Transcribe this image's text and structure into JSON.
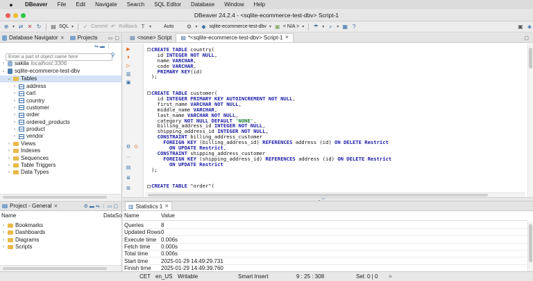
{
  "menubar": {
    "app": "DBeaver",
    "items": [
      "File",
      "Edit",
      "Navigate",
      "Search",
      "SQL Editor",
      "Database",
      "Window",
      "Help"
    ]
  },
  "window": {
    "title": "DBeaver 24.2.4 - <sqlite-ecommerce-test-dbv> Script-1"
  },
  "toolbar": {
    "sql_label": "SQL",
    "commit_label": "Commit",
    "rollback_label": "Rollback",
    "tx_mode_label": "Auto",
    "datasource_label": "sqlite-ecommerce-test-dbv",
    "schema_label": "< N/A >"
  },
  "navigator": {
    "tab_label": "Database Navigator",
    "projects_tab_label": "Projects",
    "filter_placeholder": "Enter a part of object name here",
    "connections": [
      {
        "name": "sakila",
        "detail": "localhost:3306"
      },
      {
        "name": "sqlite-ecommerce-test-dbv"
      }
    ],
    "tables_folder": "Tables",
    "tables": [
      "address",
      "cart",
      "country",
      "customer",
      "order",
      "ordered_products",
      "product",
      "vendor"
    ],
    "other_folders": [
      "Views",
      "Indexes",
      "Sequences",
      "Table Triggers",
      "Data Types"
    ]
  },
  "project": {
    "tab_label": "Project - General",
    "col_name": "Name",
    "col_datasource": "DataSo",
    "items": [
      "Bookmarks",
      "Dashboards",
      "Diagrams",
      "Scripts"
    ]
  },
  "editor": {
    "tabs": [
      "<none> Script",
      "*<sqlite-ecommerce-test-dbv> Script-1"
    ],
    "lines": [
      [
        [
          "kw",
          "CREATE TABLE "
        ],
        [
          "n",
          "country("
        ]
      ],
      [
        [
          "n",
          "  id "
        ],
        [
          "kw",
          "INTEGER NOT NULL"
        ],
        [
          "n",
          ","
        ]
      ],
      [
        [
          "n",
          "  name "
        ],
        [
          "kw",
          "VARCHAR"
        ],
        [
          "n",
          ","
        ]
      ],
      [
        [
          "n",
          "  code "
        ],
        [
          "kw",
          "VARCHAR"
        ],
        [
          "n",
          ","
        ]
      ],
      [
        [
          "kw",
          "  PRIMARY KEY"
        ],
        [
          "n",
          "(id)"
        ]
      ],
      [
        [
          "n",
          ");"
        ]
      ],
      [
        [
          "n",
          ""
        ]
      ],
      [
        [
          "n",
          ""
        ]
      ],
      [
        [
          "kw",
          "CREATE TABLE "
        ],
        [
          "n",
          "customer("
        ]
      ],
      [
        [
          "n",
          "  id "
        ],
        [
          "kw",
          "INTEGER PRIMARY KEY AUTOINCREMENT NOT NULL"
        ],
        [
          "n",
          ","
        ]
      ],
      [
        [
          "n",
          "  first_name "
        ],
        [
          "kw",
          "VARCHAR NOT NULL"
        ],
        [
          "n",
          ","
        ]
      ],
      [
        [
          "n",
          "  middle_name "
        ],
        [
          "kw",
          "VARCHAR"
        ],
        [
          "n",
          ","
        ]
      ],
      [
        [
          "n",
          "  last_name "
        ],
        [
          "kw",
          "VARCHAR NOT NULL"
        ],
        [
          "n",
          ","
        ]
      ],
      [
        [
          "n",
          "  category "
        ],
        [
          "kw",
          "NOT NULL DEFAULT "
        ],
        [
          "str",
          "'NONE'"
        ],
        [
          "n",
          ","
        ]
      ],
      [
        [
          "n",
          "  billing_address_id "
        ],
        [
          "kw",
          "INTEGER NOT NULL"
        ],
        [
          "n",
          ","
        ]
      ],
      [
        [
          "n",
          "  shipping_address_id "
        ],
        [
          "kw",
          "INTEGER NOT NULL"
        ],
        [
          "n",
          ","
        ]
      ],
      [
        [
          "kw",
          "  CONSTRAINT "
        ],
        [
          "n",
          "billing_address_customer"
        ]
      ],
      [
        [
          "kw",
          "    FOREIGN KEY "
        ],
        [
          "n",
          "(billing_address_id) "
        ],
        [
          "kw",
          "REFERENCES "
        ],
        [
          "n",
          "address (id) "
        ],
        [
          "kw",
          "ON DELETE Restrict"
        ]
      ],
      [
        [
          "kw",
          "      ON UPDATE Restrict"
        ],
        [
          "n",
          ","
        ]
      ],
      [
        [
          "kw",
          "  CONSTRAINT "
        ],
        [
          "n",
          "shipping_address_customer"
        ]
      ],
      [
        [
          "kw",
          "    FOREIGN KEY "
        ],
        [
          "n",
          "(shipping_address_id) "
        ],
        [
          "kw",
          "REFERENCES "
        ],
        [
          "n",
          "address (id) "
        ],
        [
          "kw",
          "ON DELETE Restrict"
        ]
      ],
      [
        [
          "kw",
          "      ON UPDATE Restrict"
        ]
      ],
      [
        [
          "n",
          ");"
        ]
      ],
      [
        [
          "n",
          ""
        ]
      ],
      [
        [
          "n",
          ""
        ]
      ],
      [
        [
          "kw",
          "CREATE TABLE "
        ],
        [
          "n",
          "\"order\"("
        ]
      ]
    ]
  },
  "statistics": {
    "tab_label": "Statistics 1",
    "col_name": "Name",
    "col_value": "Value",
    "rows": [
      {
        "k": "Queries",
        "v": "8"
      },
      {
        "k": "Updated Rows",
        "v": "0"
      },
      {
        "k": "Execute time",
        "v": "0.006s"
      },
      {
        "k": "Fetch time",
        "v": "0.000s"
      },
      {
        "k": "Total time",
        "v": "0.006s"
      },
      {
        "k": "Start time",
        "v": "2025-01-29 14:49:29.731"
      },
      {
        "k": "Finish time",
        "v": "2025-01-29 14:49:39.760"
      }
    ]
  },
  "statusbar": {
    "tz": "CET",
    "locale": "en_US",
    "mode": "Writable",
    "insert": "Smart Insert",
    "position": "9 : 25 : 308",
    "selection": "Sel: 0 | 0"
  },
  "colors": {
    "keyword": "#1b1ba6",
    "string": "#1a7f2e",
    "selection": "#d3e2f5"
  }
}
